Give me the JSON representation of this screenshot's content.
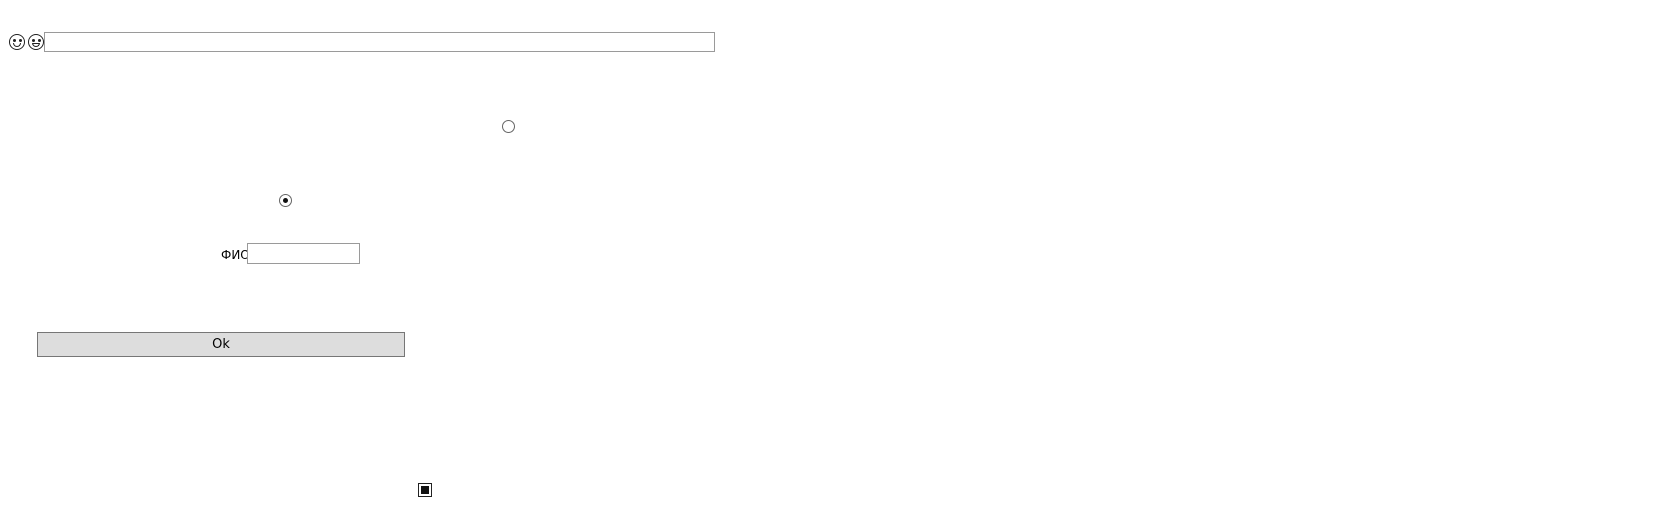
{
  "toolbar": {
    "emoji_icons": [
      "laughing-face-icon",
      "grinning-face-icon"
    ],
    "top_input": {
      "value": "",
      "placeholder": ""
    }
  },
  "radios": [
    {
      "name": "radio-option-1",
      "checked": false
    },
    {
      "name": "radio-option-2",
      "checked": true
    }
  ],
  "fio_field": {
    "label": "ФИО",
    "value": "",
    "placeholder": ""
  },
  "ok_button": {
    "label": "Ok"
  },
  "checkbox": {
    "checked": true
  }
}
